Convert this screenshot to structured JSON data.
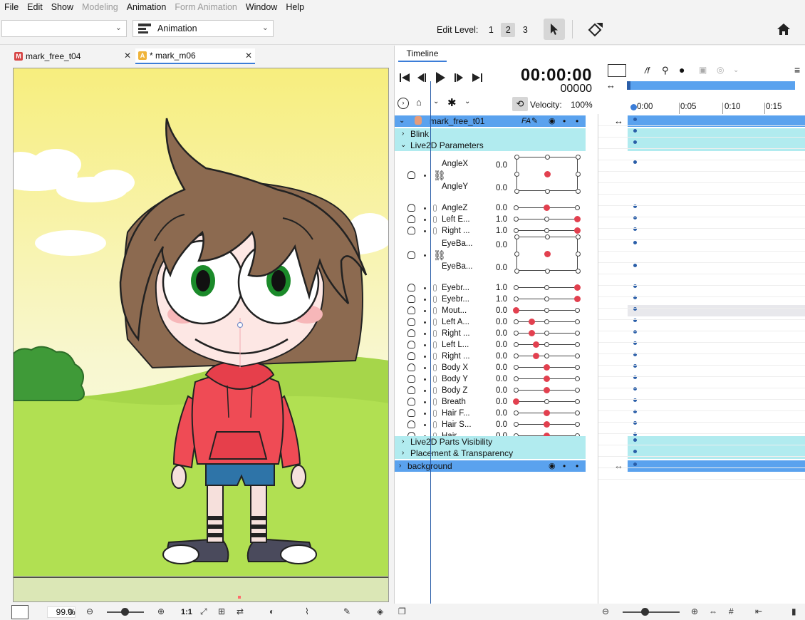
{
  "menu": [
    "File",
    "Edit",
    "Show",
    "Modeling",
    "Animation",
    "Form Animation",
    "Window",
    "Help"
  ],
  "menu_disabled": [
    "Modeling",
    "Form Animation"
  ],
  "toolbar": {
    "left_dropdown_value": "",
    "workspace_dropdown_value": "Animation",
    "edit_level_label": "Edit Level:",
    "edit_levels": [
      "1",
      "2",
      "3"
    ],
    "edit_level_active": "2"
  },
  "doc_tabs": [
    {
      "label": "mark_free_t04",
      "badge": "M",
      "badge_color": "#d64545",
      "active": false
    },
    {
      "label": "* mark_m06",
      "badge": "A",
      "badge_color": "#f0b43a",
      "active": true
    }
  ],
  "statusbar": {
    "zoom": "99.0",
    "zoom_unit": "%",
    "ratio_label": "1:1"
  },
  "timeline": {
    "tab_label": "Timeline",
    "time": "00:00:00",
    "frame": "00000",
    "velocity_label": "Velocity:",
    "velocity_value": "100%",
    "fps_label": "/f",
    "ticks": [
      "0:00",
      "0:05",
      "0:10",
      "0:15"
    ],
    "object_name": "mark_free_t01",
    "object_tags": "FA",
    "groups": {
      "blink": "Blink",
      "params": "Live2D Parameters",
      "parts": "Live2D Parts Visibility",
      "placement": "Placement & Transparency"
    },
    "background_name": "background",
    "angle_xy": {
      "x_label": "AngleX",
      "x_value": "0.0",
      "y_label": "AngleY",
      "y_value": "0.0"
    },
    "eye_ball": {
      "x_label": "EyeBa...",
      "x_value": "0.0",
      "y_label": "EyeBa...",
      "y_value": "0.0"
    },
    "params_a": [
      {
        "label": "AngleZ",
        "value": "0.0",
        "pos": 0.5
      },
      {
        "label": "Left E...",
        "value": "1.0",
        "pos": 1.0
      },
      {
        "label": "Right ...",
        "value": "1.0",
        "pos": 1.0
      }
    ],
    "params_b": [
      {
        "label": "Eyebr...",
        "value": "1.0",
        "pos": 1.0
      },
      {
        "label": "Eyebr...",
        "value": "1.0",
        "pos": 1.0
      },
      {
        "label": "Mout...",
        "value": "0.0",
        "pos": 0.0
      },
      {
        "label": "Left A...",
        "value": "0.0",
        "pos": 0.25
      },
      {
        "label": "Right ...",
        "value": "0.0",
        "pos": 0.25
      },
      {
        "label": "Left L...",
        "value": "0.0",
        "pos": 0.33
      },
      {
        "label": "Right ...",
        "value": "0.0",
        "pos": 0.33
      },
      {
        "label": "Body X",
        "value": "0.0",
        "pos": 0.5
      },
      {
        "label": "Body Y",
        "value": "0.0",
        "pos": 0.5
      },
      {
        "label": "Body Z",
        "value": "0.0",
        "pos": 0.5
      },
      {
        "label": "Breath",
        "value": "0.0",
        "pos": 0.0
      },
      {
        "label": "Hair F...",
        "value": "0.0",
        "pos": 0.5
      },
      {
        "label": "Hair S...",
        "value": "0.0",
        "pos": 0.5
      },
      {
        "label": "Hair ...",
        "value": "0.0",
        "pos": 0.5
      }
    ]
  },
  "colors": {
    "group_row": "#b1ebef",
    "object_row": "#5aa2ee",
    "keyknob": "#e2404f",
    "accent": "#3b7dd8"
  }
}
